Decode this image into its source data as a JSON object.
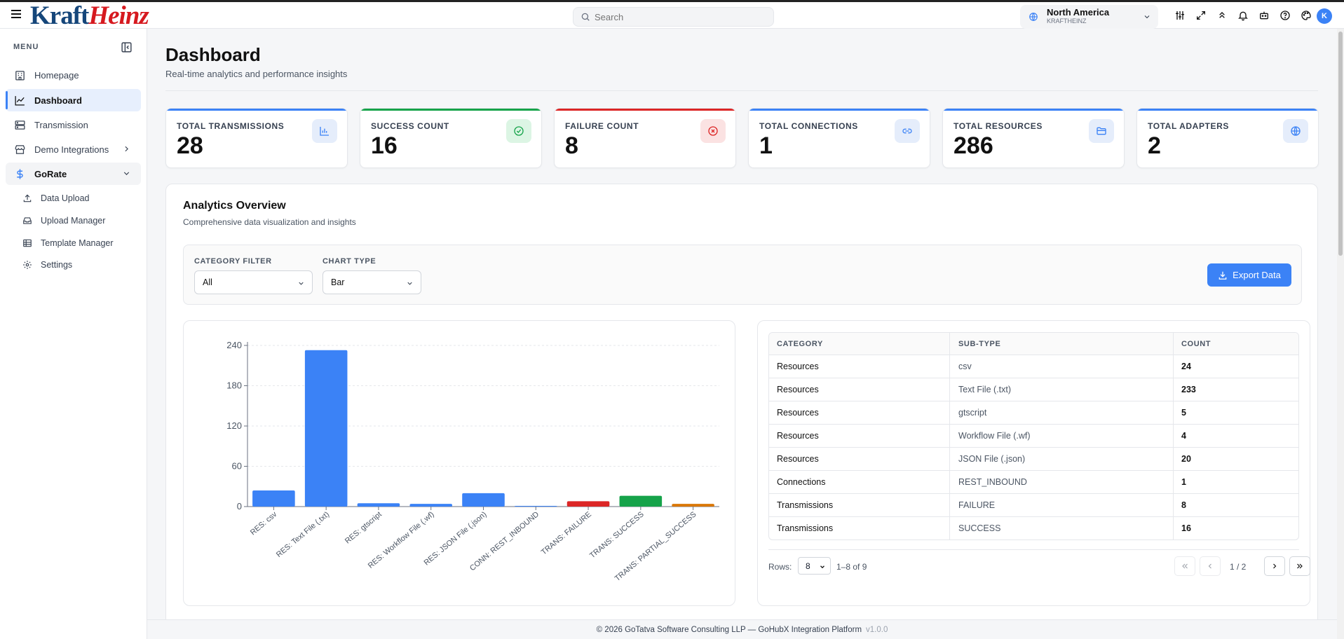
{
  "brand": {
    "part1": "Kraft",
    "part2": "Heinz"
  },
  "header": {
    "search_placeholder": "Search",
    "region": {
      "name": "North America",
      "sub": "KRAFTHEINZ"
    },
    "avatar_initial": "K"
  },
  "sidebar": {
    "menu_label": "MENU",
    "items": [
      {
        "label": "Homepage",
        "icon": "building-icon"
      },
      {
        "label": "Dashboard",
        "icon": "chart-line-icon",
        "active": true
      },
      {
        "label": "Transmission",
        "icon": "server-icon"
      },
      {
        "label": "Demo Integrations",
        "icon": "store-icon"
      },
      {
        "label": "GoRate",
        "icon": "dollar-icon",
        "expanded": true
      }
    ],
    "subitems": [
      {
        "label": "Data Upload",
        "icon": "upload-icon"
      },
      {
        "label": "Upload Manager",
        "icon": "inbox-icon"
      },
      {
        "label": "Template Manager",
        "icon": "table-icon"
      },
      {
        "label": "Settings",
        "icon": "gear-icon"
      }
    ]
  },
  "page": {
    "title": "Dashboard",
    "subtitle": "Real-time analytics and performance insights"
  },
  "stats": [
    {
      "label": "TOTAL TRANSMISSIONS",
      "value": "28",
      "color": "#3b82f6",
      "icon": "bar-chart-icon"
    },
    {
      "label": "SUCCESS COUNT",
      "value": "16",
      "color": "#16a34a",
      "icon": "check-circle-icon"
    },
    {
      "label": "FAILURE COUNT",
      "value": "8",
      "color": "#dc2626",
      "icon": "x-circle-icon"
    },
    {
      "label": "TOTAL CONNECTIONS",
      "value": "1",
      "color": "#3b82f6",
      "icon": "link-icon"
    },
    {
      "label": "TOTAL RESOURCES",
      "value": "286",
      "color": "#3b82f6",
      "icon": "folder-icon"
    },
    {
      "label": "TOTAL ADAPTERS",
      "value": "2",
      "color": "#3b82f6",
      "icon": "globe-icon"
    }
  ],
  "analytics": {
    "title": "Analytics Overview",
    "subtitle": "Comprehensive data visualization and insights",
    "filter_label": "CATEGORY FILTER",
    "filter_value": "All",
    "chart_type_label": "CHART TYPE",
    "chart_type_value": "Bar",
    "export_label": "Export Data"
  },
  "chart_data": {
    "type": "bar",
    "categories": [
      "RES: csv",
      "RES: Text File (.txt)",
      "RES: gtscript",
      "RES: Workflow File (.wf)",
      "RES: JSON File (.json)",
      "CONN: REST_INBOUND",
      "TRANS: FAILURE",
      "TRANS: SUCCESS",
      "TRANS: PARTIAL_SUCCESS"
    ],
    "values": [
      24,
      233,
      5,
      4,
      20,
      1,
      8,
      16,
      4
    ],
    "colors": [
      "#3b82f6",
      "#3b82f6",
      "#3b82f6",
      "#3b82f6",
      "#3b82f6",
      "#3b82f6",
      "#dc2626",
      "#16a34a",
      "#d97706"
    ],
    "ylim": [
      0,
      240
    ],
    "yticks": [
      0,
      60,
      120,
      180,
      240
    ],
    "grid": true
  },
  "table": {
    "headers": [
      "CATEGORY",
      "SUB-TYPE",
      "COUNT"
    ],
    "rows": [
      [
        "Resources",
        "csv",
        "24"
      ],
      [
        "Resources",
        "Text File (.txt)",
        "233"
      ],
      [
        "Resources",
        "gtscript",
        "5"
      ],
      [
        "Resources",
        "Workflow File (.wf)",
        "4"
      ],
      [
        "Resources",
        "JSON File (.json)",
        "20"
      ],
      [
        "Connections",
        "REST_INBOUND",
        "1"
      ],
      [
        "Transmissions",
        "FAILURE",
        "8"
      ],
      [
        "Transmissions",
        "SUCCESS",
        "16"
      ]
    ],
    "rows_label": "Rows:",
    "rows_value": "8",
    "range": "1–8 of 9",
    "page": "1 / 2"
  },
  "footer": {
    "text": "© 2026 GoTatva Software Consulting LLP — GoHubX Integration Platform",
    "version": "v1.0.0"
  }
}
